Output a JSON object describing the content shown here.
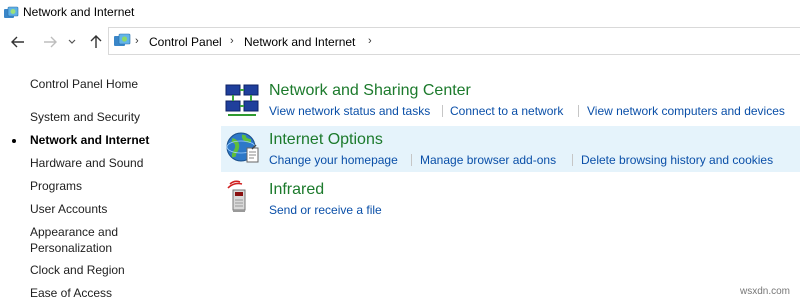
{
  "window": {
    "title": "Network and Internet"
  },
  "address": {
    "crumbs": [
      "Control Panel",
      "Network and Internet"
    ]
  },
  "sidebar": {
    "items": [
      {
        "label": "Control Panel Home"
      },
      {
        "label": "System and Security"
      },
      {
        "label": "Network and Internet",
        "current": true
      },
      {
        "label": "Hardware and Sound"
      },
      {
        "label": "Programs"
      },
      {
        "label": "User Accounts"
      },
      {
        "label": "Appearance and",
        "label2": "Personalization"
      },
      {
        "label": "Clock and Region"
      },
      {
        "label": "Ease of Access"
      }
    ]
  },
  "categories": [
    {
      "title": "Network and Sharing Center",
      "icon": "network-sharing-icon",
      "links": [
        "View network status and tasks",
        "Connect to a network",
        "View network computers and devices"
      ]
    },
    {
      "title": "Internet Options",
      "icon": "globe-icon",
      "links": [
        "Change your homepage",
        "Manage browser add-ons",
        "Delete browsing history and cookies"
      ]
    },
    {
      "title": "Infrared",
      "icon": "infrared-icon",
      "links": [
        "Send or receive a file"
      ]
    }
  ],
  "watermark": "wsxdn.com",
  "colors": {
    "title_green": "#1c7a2c",
    "link_blue": "#0a4fa8",
    "hover_bg": "#e5f3fb"
  }
}
